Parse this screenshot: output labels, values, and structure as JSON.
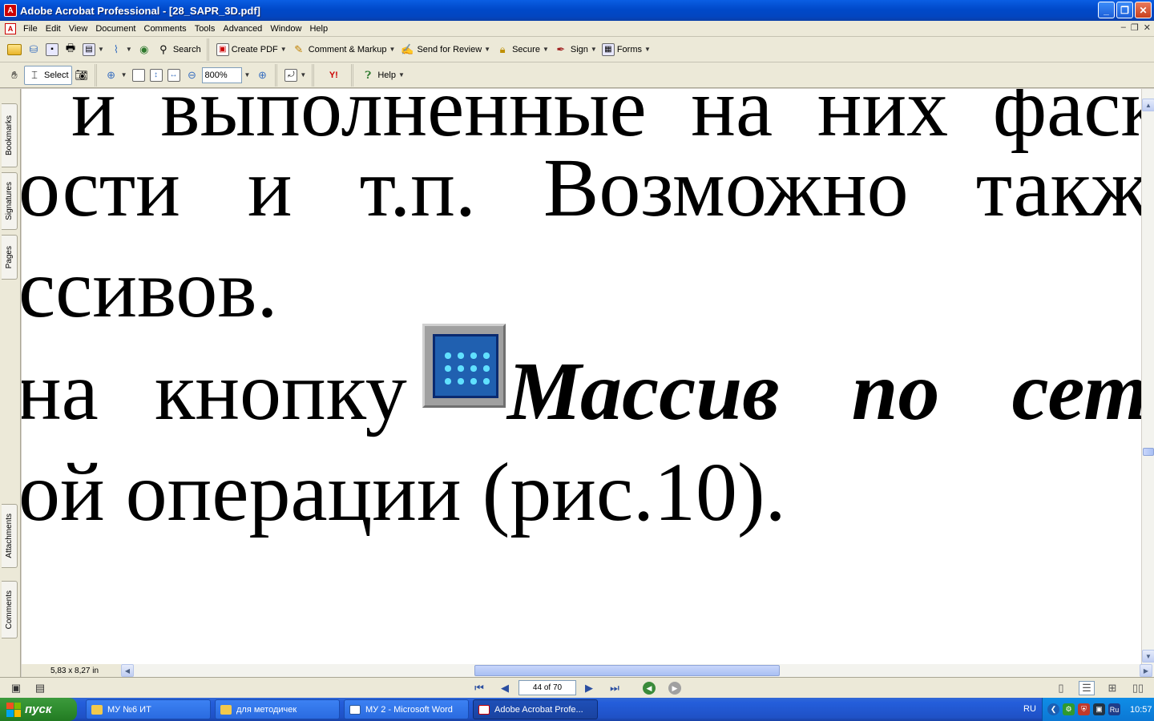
{
  "window": {
    "title": "Adobe Acrobat Professional - [28_SAPR_3D.pdf]",
    "app_icon": "acrobat-icon",
    "min_glyph": "_",
    "max_glyph": "❐",
    "close_glyph": "✕"
  },
  "menu": {
    "items": [
      "File",
      "Edit",
      "View",
      "Document",
      "Comments",
      "Tools",
      "Advanced",
      "Window",
      "Help"
    ],
    "mdi_min": "–",
    "mdi_restore": "❐",
    "mdi_close": "✕"
  },
  "toolbar1": {
    "search_label": "Search",
    "create_pdf_label": "Create PDF",
    "comment_markup_label": "Comment & Markup",
    "send_review_label": "Send for Review",
    "secure_label": "Secure",
    "sign_label": "Sign",
    "forms_label": "Forms"
  },
  "toolbar2": {
    "select_label": "Select",
    "zoom_value": "800%",
    "help_label": "Help",
    "yahoo_label": "Y!"
  },
  "navpanel": {
    "tabs": [
      "Bookmarks",
      "Signatures",
      "Pages",
      "Attachments",
      "Comments"
    ]
  },
  "document": {
    "line1": [
      "и",
      "выполненные",
      "на",
      "них",
      "фаск"
    ],
    "line2": [
      "ости",
      "и",
      "т.п.",
      "Возможно",
      "такж"
    ],
    "line3": "ссивов.",
    "line4_plain": [
      "на",
      "кнопку"
    ],
    "line4_bold": [
      "Массив",
      "по",
      "сет"
    ],
    "line5": "ой операции (рис.10)."
  },
  "statusbar": {
    "page_size": "5,83 x 8,27 in",
    "page_indicator": "44 of 70"
  },
  "taskbar": {
    "start_label": "пуск",
    "tasks": [
      {
        "label": "МУ №6 ИТ",
        "icon": "folder-icon"
      },
      {
        "label": "для методичек",
        "icon": "folder-icon"
      },
      {
        "label": "МУ 2 - Microsoft Word",
        "icon": "word-icon"
      },
      {
        "label": "Adobe Acrobat Profe...",
        "icon": "acrobat-icon"
      }
    ],
    "lang": "RU",
    "lang_tray": "Ru",
    "clock": "10:57"
  }
}
